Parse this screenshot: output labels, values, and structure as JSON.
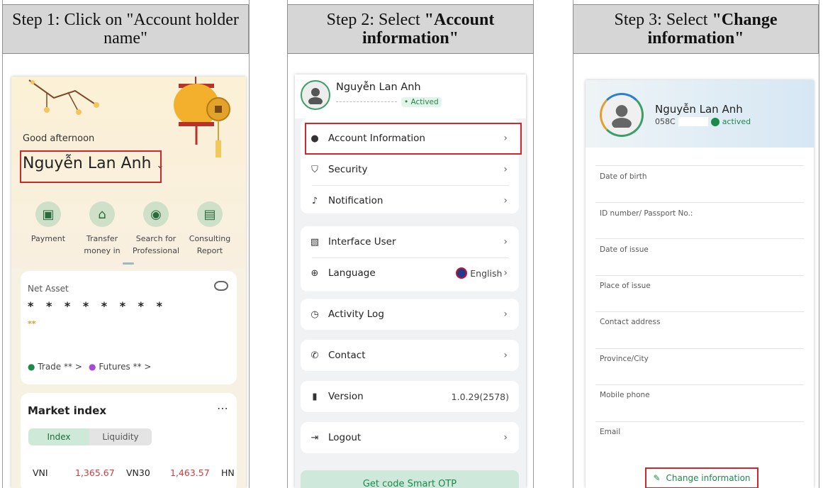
{
  "steps": {
    "step1_title": "Step 1: Click on \"Account holder name\"",
    "step2_prefix": "Step 2: Select ",
    "step2_bold": "\"Account information\"",
    "step3_prefix": "Step 3: Select ",
    "step3_bold": "\"Change information\""
  },
  "screen1": {
    "greeting": "Good afternoon",
    "user_name": "Nguyễn Lan Anh",
    "shortcuts": [
      {
        "label": "Payment",
        "icon": "wallet-icon"
      },
      {
        "label": "Transfer money in",
        "icon": "bank-icon"
      },
      {
        "label": "Search for Professional",
        "icon": "search-person-icon"
      },
      {
        "label": "Consulting Report",
        "icon": "report-icon"
      }
    ],
    "net_asset_label": "Net Asset",
    "net_asset_value": "* * * * * * * *",
    "net_asset_change": "**",
    "trade_label": "Trade",
    "trade_value": "** >",
    "futures_label": "Futures",
    "futures_value": "** >",
    "market_title": "Market index",
    "more_icon": "⋯",
    "tab_index": "Index",
    "tab_liquidity": "Liquidity",
    "indices": [
      {
        "name": "VNI",
        "value": "1,365.67"
      },
      {
        "name": "VN30",
        "value": "1,463.57"
      },
      {
        "name": "HN",
        "value": ""
      }
    ]
  },
  "screen2": {
    "user_name": "Nguyễn Lan Anh",
    "status": "• Actived",
    "items_group1": [
      {
        "label": "Account Information",
        "icon": "person-icon"
      },
      {
        "label": "Security",
        "icon": "shield-icon"
      },
      {
        "label": "Notification",
        "icon": "bell-icon"
      }
    ],
    "items_group2": [
      {
        "label": "Interface User",
        "icon": "image-icon"
      },
      {
        "label": "Language",
        "icon": "globe-icon",
        "value": "English"
      }
    ],
    "activity_log": "Activity Log",
    "contact": "Contact",
    "version_label": "Version",
    "version_value": "1.0.29(2578)",
    "logout": "Logout",
    "otp_button": "Get code Smart OTP"
  },
  "screen3": {
    "user_name": "Nguyễn Lan Anh",
    "account_prefix": "058C",
    "status": "actived",
    "fields": [
      "Date of birth",
      "ID number/ Passport No.:",
      "Date of issue",
      "Place of issue",
      "Contact address",
      "Province/City",
      "Mobile phone",
      "Email"
    ],
    "change_button": "Change information"
  },
  "colors": {
    "highlight_red": "#d0262d",
    "brand_green": "#1c8a4a",
    "price_red": "#d23b3b"
  }
}
